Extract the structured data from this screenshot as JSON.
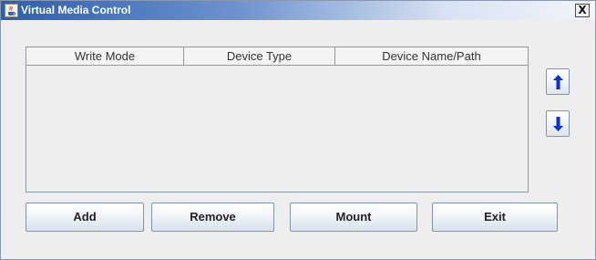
{
  "window": {
    "title": "Virtual Media Control",
    "close_label": "X",
    "icon": "java-cup-icon"
  },
  "table": {
    "columns": [
      "Write Mode",
      "Device Type",
      "Device Name/Path"
    ],
    "rows": []
  },
  "side_buttons": {
    "up_icon": "arrow-up-icon",
    "down_icon": "arrow-down-icon"
  },
  "buttons": {
    "add": "Add",
    "remove": "Remove",
    "mount": "Mount",
    "exit": "Exit"
  },
  "colors": {
    "titlebar_start": "#2a5fae",
    "arrow_blue": "#0a2fd6",
    "background": "#eeeeee"
  }
}
